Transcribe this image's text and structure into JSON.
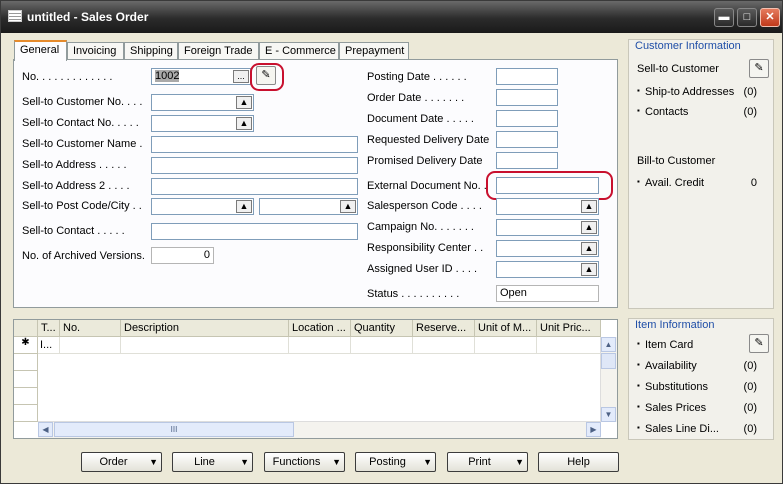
{
  "window": {
    "title": "untitled - Sales Order",
    "min": "▬",
    "max": "□",
    "close": "✕"
  },
  "tabs": [
    "General",
    "Invoicing",
    "Shipping",
    "Foreign Trade",
    "E - Commerce",
    "Prepayment"
  ],
  "left": {
    "no_label": "No. . . . . . . . . . . . .",
    "no_value": "1002",
    "assist": "...",
    "edit": "✎",
    "sell_to_customer_no": "Sell-to Customer No. . . .",
    "sell_to_contact_no": "Sell-to Contact No. . . . .",
    "sell_to_customer_name": "Sell-to Customer Name .",
    "sell_to_address": "Sell-to Address . . . . .",
    "sell_to_address2": "Sell-to Address 2 . . . .",
    "sell_to_post_code_city": "Sell-to Post Code/City . .",
    "sell_to_contact": "Sell-to Contact . . . . .",
    "archived_label": "No. of Archived Versions.",
    "archived_value": "0"
  },
  "right": {
    "posting_date": "Posting Date . . . . . .",
    "order_date": "Order Date . . . . . . .",
    "document_date": "Document Date . . . . .",
    "requested_delivery_date": "Requested Delivery Date",
    "promised_delivery_date": "Promised Delivery Date",
    "external_document_no": "External Document No. .",
    "salesperson_code": "Salesperson Code . . . .",
    "campaign_no": "Campaign No. . . . . . .",
    "responsibility_center": "Responsibility Center . .",
    "assigned_user_id": "Assigned User ID . . . .",
    "status_label": "Status . . . . . . . . . .",
    "status_value": "Open"
  },
  "customer_info": {
    "header": "Customer Information",
    "sell_to_customer": "Sell-to Customer",
    "ship_to_addresses": "Ship-to Addresses",
    "ship_to_count": "(0)",
    "contacts": "Contacts",
    "contacts_count": "(0)",
    "bill_to_customer": "Bill-to Customer",
    "avail_credit": "Avail. Credit",
    "avail_credit_value": "0",
    "bullet": "▪"
  },
  "item_info": {
    "header": "Item Information",
    "item_card": "Item Card",
    "availability": "Availability",
    "availability_count": "(0)",
    "substitutions": "Substitutions",
    "substitutions_count": "(0)",
    "sales_prices": "Sales Prices",
    "sales_prices_count": "(0)",
    "sales_line_di": "Sales Line Di...",
    "sales_line_di_count": "(0)"
  },
  "lines": {
    "columns": [
      "T...",
      "No.",
      "Description",
      "Location ...",
      "Quantity",
      "Reserve...",
      "Unit of M...",
      "Unit Pric..."
    ],
    "row_marker": "✱",
    "first_type": "I...",
    "scroll_grip": "III"
  },
  "buttons": {
    "order": "Order",
    "line": "Line",
    "functions": "Functions",
    "posting": "Posting",
    "print": "Print",
    "help": "Help",
    "arrow": "▼"
  }
}
